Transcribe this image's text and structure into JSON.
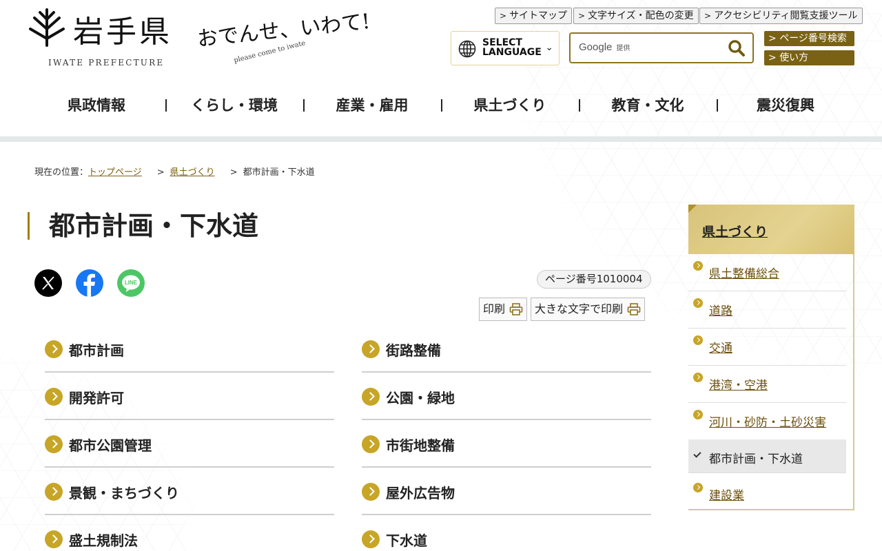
{
  "header": {
    "logo_title": "岩手県",
    "logo_en": "IWATE PREFECTURE",
    "catch_main": "おでんせ、いわて!",
    "catch_sub": "please come to iwate",
    "util_links": [
      "サイトマップ",
      "文字サイズ・配色の変更",
      "アクセシビリティ閲覧支援ツール"
    ],
    "language_label": "SELECT LANGUAGE",
    "search_provider": "Google",
    "search_provider_note": "提供",
    "page_number_search": "ページ番号検索",
    "how_to_use": "使い方"
  },
  "global_nav": [
    "県政情報",
    "くらし・環境",
    "産業・雇用",
    "県土づくり",
    "教育・文化",
    "震災復興"
  ],
  "breadcrumb": {
    "prefix": "現在の位置：",
    "items": [
      "トップページ",
      "県土づくり"
    ],
    "current": "都市計画・下水道",
    "separator": ">"
  },
  "page": {
    "title": "都市計画・下水道",
    "page_number": "ページ番号1010004",
    "print_label": "印刷",
    "print_large_label": "大きな文字で印刷"
  },
  "sns": [
    "x-icon",
    "facebook-icon",
    "line-icon"
  ],
  "sns_line_text": "LINE",
  "links_left": [
    "都市計画",
    "開発許可",
    "都市公園管理",
    "景観・まちづくり",
    "盛土規制法"
  ],
  "links_right": [
    "街路整備",
    "公園・緑地",
    "市街地整備",
    "屋外広告物",
    "下水道"
  ],
  "side_nav": {
    "heading": "県土づくり",
    "items": [
      "県土整備総合",
      "道路",
      "交通",
      "港湾・空港",
      "河川・砂防・土砂災害",
      "都市計画・下水道",
      "建設業"
    ],
    "current_index": 5
  },
  "colors": {
    "gold": "#c7a527",
    "dark_gold": "#7a6215",
    "link_brown": "#7a5e10"
  }
}
